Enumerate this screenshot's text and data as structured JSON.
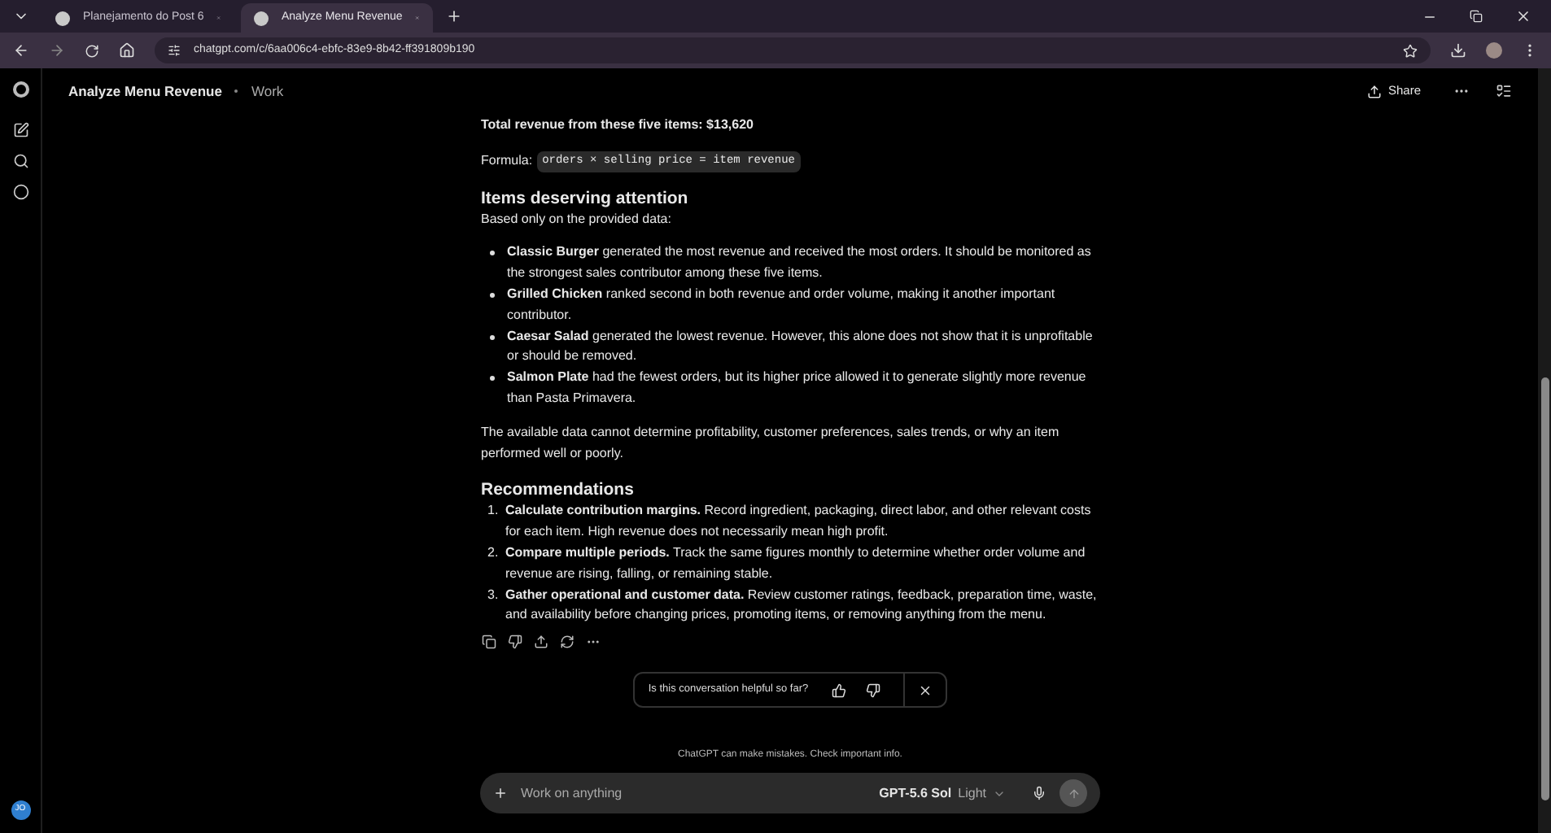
{
  "browser": {
    "tabs": [
      {
        "title": "Planejamento do Post 6",
        "selected": false
      },
      {
        "title": "Analyze Menu Revenue",
        "selected": true
      }
    ],
    "url": "chatgpt.com/c/6aa006c4-ebfc-83e9-8b42-ff391809b190"
  },
  "sidebar": {
    "avatar": "JO"
  },
  "header": {
    "title": "Analyze Menu Revenue",
    "project": "Work",
    "share": "Share"
  },
  "message": {
    "total": "Total revenue from these five items: $13,620",
    "formula_label": "Formula:",
    "formula_code": "orders × selling price = item revenue",
    "section_1": {
      "heading": "Items deserving attention",
      "intro": "Based only on the provided data:",
      "bullets": [
        "**Classic Burger** generated the most revenue and received the most orders. It should be monitored as the strongest sales contributor among these five items.",
        "**Grilled Chicken** ranked second in both revenue and order volume, making it another important contributor.",
        "**Caesar Salad** generated the lowest revenue. However, this alone does not show that it is unprofitable or should be removed.",
        "**Salmon Plate** had the fewest orders, but its higher price allowed it to generate slightly more revenue than Pasta Primavera."
      ]
    },
    "note": "The available data cannot determine profitability, customer preferences, sales trends, or why an item performed well or poorly.",
    "section_2": {
      "heading": "Recommendations",
      "items": [
        {
          "number": "1.",
          "text": "**Calculate contribution margins.** Record ingredient, packaging, direct labor, and other relevant costs for each item. High revenue does not necessarily mean high profit."
        },
        {
          "number": "2.",
          "text": "**Compare multiple periods.** Track the same figures monthly to determine whether order volume and revenue are rising, falling, or remaining stable."
        },
        {
          "number": "3.",
          "text": "**Gather operational and customer data.** Review customer ratings, feedback, preparation time, waste, and availability before changing prices, promoting items, or removing anything from the menu."
        }
      ]
    }
  },
  "feedback": {
    "question": "Is this conversation helpful so far?"
  },
  "disclaimer": "ChatGPT can make mistakes. Check important info.",
  "composer": {
    "placeholder": "Work on anything",
    "model": "GPT-5.6 Sol",
    "mode": "Light"
  }
}
